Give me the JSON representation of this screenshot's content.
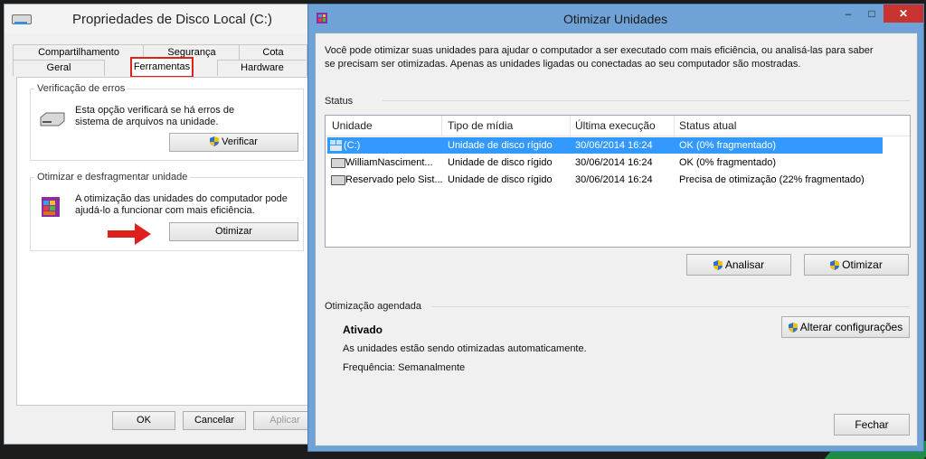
{
  "properties_window": {
    "title": "Propriedades de Disco Local (C:)",
    "tabs_row1": [
      "Compartilhamento",
      "Segurança",
      "Cota"
    ],
    "tabs_row2": [
      "Geral",
      "Ferramentas",
      "Hardware"
    ],
    "active_tab": "Ferramentas",
    "error_check": {
      "title": "Verificação de erros",
      "text": "Esta opção verificará se há erros de sistema de arquivos na unidade.",
      "button": "Verificar"
    },
    "optimize_group": {
      "title": "Otimizar e desfragmentar unidade",
      "text": "A otimização das unidades do computador pode ajudá-lo a funcionar com mais eficiência.",
      "button": "Otimizar"
    },
    "buttons": {
      "ok": "OK",
      "cancel": "Cancelar",
      "apply": "Aplicar"
    },
    "annotation_arrow_color": "#e0201c"
  },
  "optimize_window": {
    "title": "Otimizar Unidades",
    "controls": {
      "minimize": "–",
      "maximize": "□",
      "close": "✕"
    },
    "intro": "Você pode otimizar suas unidades para ajudar o computador a ser executado com mais eficiência, ou analisá-las para saber se precisam ser otimizadas. Apenas as unidades ligadas ou conectadas ao seu computador são mostradas.",
    "status_label": "Status",
    "columns": [
      "Unidade",
      "Tipo de mídia",
      "Última execução",
      "Status atual"
    ],
    "rows": [
      {
        "drive": "(C:)",
        "media": "Unidade de disco rígido",
        "last_run": "30/06/2014 16:24",
        "status": "OK (0% fragmentado)",
        "selected": true
      },
      {
        "drive": "WilliamNasciment...",
        "media": "Unidade de disco rígido",
        "last_run": "30/06/2014 16:24",
        "status": "OK (0% fragmentado)",
        "selected": false
      },
      {
        "drive": "Reservado pelo Sist...",
        "media": "Unidade de disco rígido",
        "last_run": "30/06/2014 16:24",
        "status": "Precisa de otimização (22% fragmentado)",
        "selected": false
      }
    ],
    "buttons": {
      "analyze": "Analisar",
      "optimize": "Otimizar",
      "change_settings": "Alterar configurações",
      "close": "Fechar"
    },
    "scheduled": {
      "label": "Otimização agendada",
      "state": "Ativado",
      "description": "As unidades estão sendo otimizadas automaticamente.",
      "frequency": "Frequência: Semanalmente"
    }
  }
}
